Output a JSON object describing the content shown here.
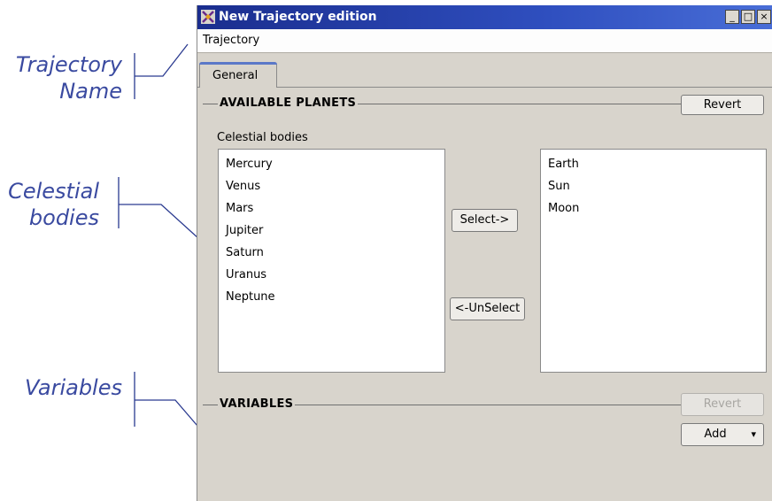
{
  "annotations": {
    "trajectory_name": [
      "Trajectory",
      "Name"
    ],
    "celestial_bodies": [
      "Celestial",
      "bodies"
    ],
    "variables": "Variables"
  },
  "window": {
    "title": "New Trajectory edition",
    "controls": [
      "_",
      "□",
      "×"
    ]
  },
  "name_field": {
    "value": "Trajectory"
  },
  "tabs": [
    {
      "label": "General",
      "active": true
    }
  ],
  "available_planets": {
    "heading": "AVAILABLE PLANETS",
    "revert_label": "Revert",
    "list_label": "Celestial bodies",
    "available": [
      "Mercury",
      "Venus",
      "Mars",
      "Jupiter",
      "Saturn",
      "Uranus",
      "Neptune"
    ],
    "selected": [
      "Earth",
      "Sun",
      "Moon"
    ],
    "select_label": "Select->",
    "unselect_label": "<-UnSelect"
  },
  "variables": {
    "heading": "VARIABLES",
    "revert_label": "Revert",
    "revert_enabled": false,
    "add_label": "Add",
    "add_arrow": "▾"
  },
  "colors": {
    "annotation": "#3a4aa0",
    "titlebar": "#1a2d8e",
    "window_bg": "#d8d4cc"
  }
}
